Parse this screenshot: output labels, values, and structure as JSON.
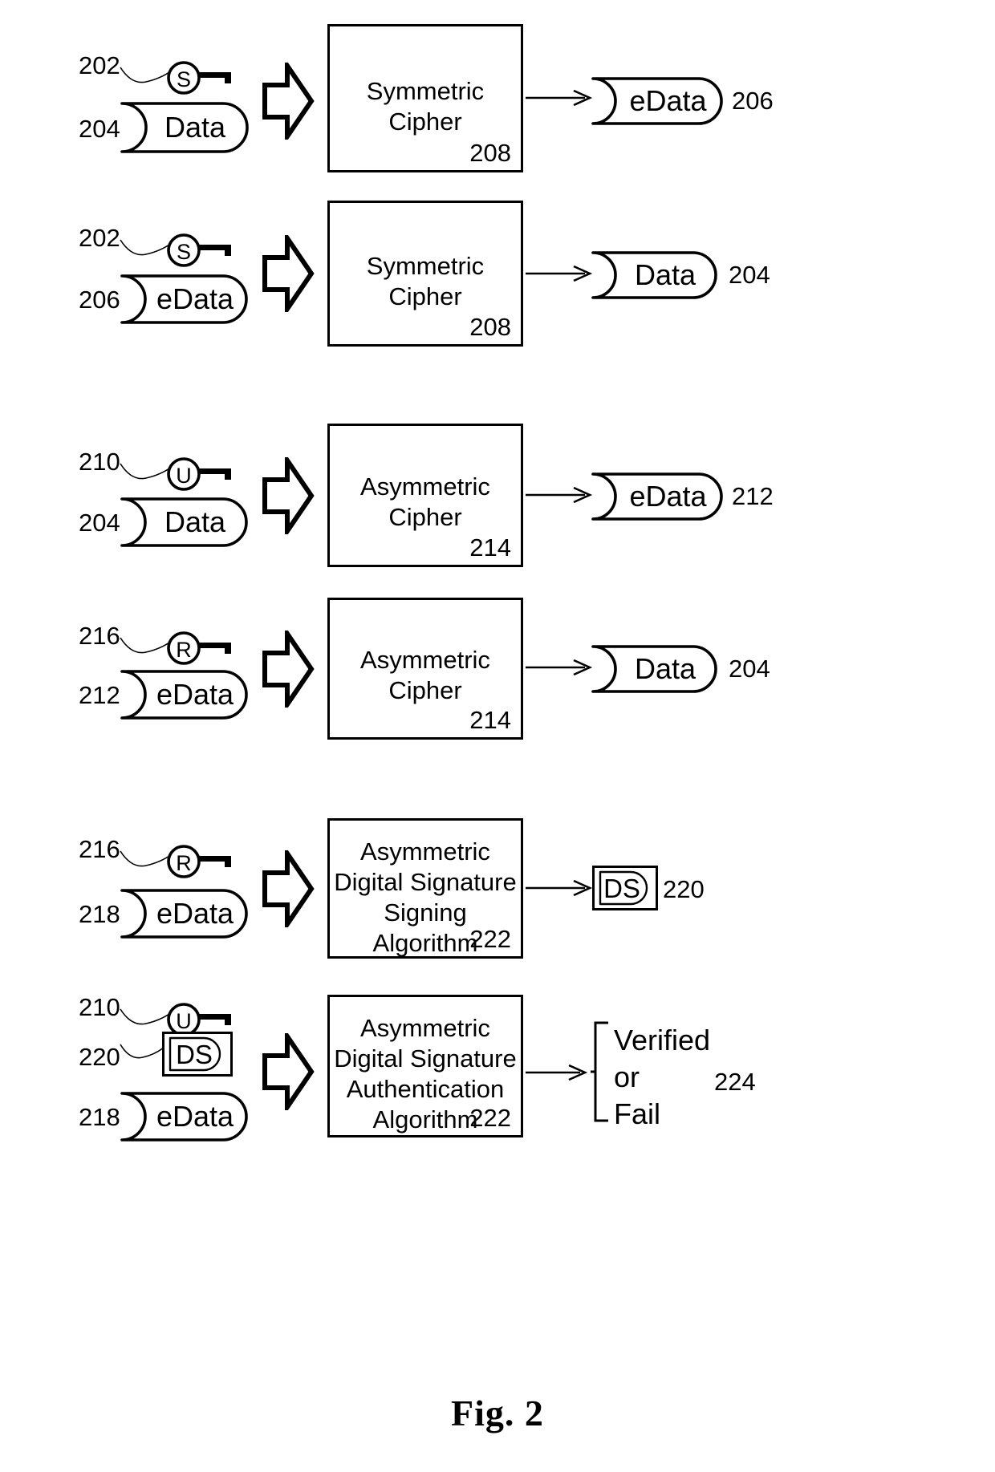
{
  "figure": {
    "caption": "Fig. 2"
  },
  "rows": [
    {
      "id": "symmetric-encrypt",
      "key": {
        "ref": "202",
        "glyph": "S",
        "icon": "key-icon"
      },
      "input": {
        "ref": "204",
        "label": "Data",
        "icon": "data-cylinder-icon"
      },
      "process": {
        "title": "Symmetric\nCipher",
        "num": "208"
      },
      "output": {
        "ref": "206",
        "label": "eData",
        "icon": "data-cylinder-icon"
      }
    },
    {
      "id": "symmetric-decrypt",
      "key": {
        "ref": "202",
        "glyph": "S",
        "icon": "key-icon"
      },
      "input": {
        "ref": "206",
        "label": "eData",
        "icon": "data-cylinder-icon"
      },
      "process": {
        "title": "Symmetric\nCipher",
        "num": "208"
      },
      "output": {
        "ref": "204",
        "label": "Data",
        "icon": "data-cylinder-icon"
      }
    },
    {
      "id": "asymmetric-encrypt",
      "key": {
        "ref": "210",
        "glyph": "U",
        "icon": "key-icon"
      },
      "input": {
        "ref": "204",
        "label": "Data",
        "icon": "data-cylinder-icon"
      },
      "process": {
        "title": "Asymmetric\nCipher",
        "num": "214"
      },
      "output": {
        "ref": "212",
        "label": "eData",
        "icon": "data-cylinder-icon"
      }
    },
    {
      "id": "asymmetric-decrypt",
      "key": {
        "ref": "216",
        "glyph": "R",
        "icon": "key-icon"
      },
      "input": {
        "ref": "212",
        "label": "eData",
        "icon": "data-cylinder-icon"
      },
      "process": {
        "title": "Asymmetric\nCipher",
        "num": "214"
      },
      "output": {
        "ref": "204",
        "label": "Data",
        "icon": "data-cylinder-icon"
      }
    },
    {
      "id": "signature-signing",
      "key": {
        "ref": "216",
        "glyph": "R",
        "icon": "key-icon"
      },
      "input": {
        "ref": "218",
        "label": "eData",
        "icon": "data-cylinder-icon"
      },
      "process": {
        "title": "Asymmetric\nDigital Signature\nSigning\nAlgorithm",
        "num": "222"
      },
      "output": {
        "ref": "220",
        "label": "DS",
        "icon": "digital-signature-icon"
      }
    },
    {
      "id": "signature-authentication",
      "key": {
        "ref": "210",
        "glyph": "U",
        "icon": "key-icon"
      },
      "signature": {
        "ref": "220",
        "label": "DS",
        "icon": "digital-signature-icon"
      },
      "input": {
        "ref": "218",
        "label": "eData",
        "icon": "data-cylinder-icon"
      },
      "process": {
        "title": "Asymmetric\nDigital Signature\nAuthentication\nAlgorithm",
        "num": "222"
      },
      "output": {
        "ref": "224",
        "label": "Verified\nor\nFail",
        "icon": "result-bracket-icon"
      }
    }
  ],
  "colors": {
    "stroke": "#000000",
    "background": "#ffffff"
  }
}
